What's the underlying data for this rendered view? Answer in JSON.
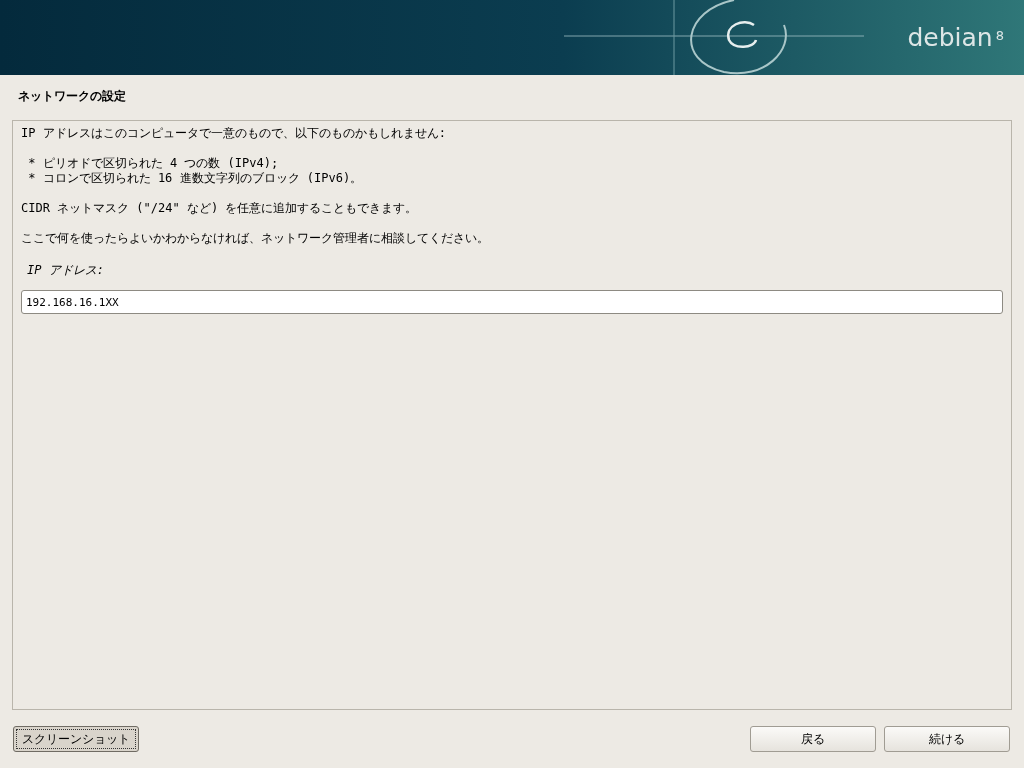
{
  "banner": {
    "logo": "debian",
    "version": "8"
  },
  "title": "ネットワークの設定",
  "description": [
    [
      "IP アドレスはこのコンピュータで一意のもので、以下のものかもしれません:"
    ],
    [
      " * ピリオドで区切られた 4 つの数 (IPv4);",
      " * コロンで区切られた 16 進数文字列のブロック (IPv6)。"
    ],
    [
      "CIDR ネットマスク (\"/24\" など) を任意に追加することもできます。"
    ],
    [
      "ここで何を使ったらよいかわからなければ、ネットワーク管理者に相談してください。"
    ]
  ],
  "field": {
    "label": "IP アドレス:",
    "value": "192.168.16.1XX"
  },
  "buttons": [
    {
      "label": "スクリーンショット",
      "focused": true
    },
    {
      "label": "戻る",
      "focused": false
    },
    {
      "label": "続ける",
      "focused": false
    }
  ]
}
